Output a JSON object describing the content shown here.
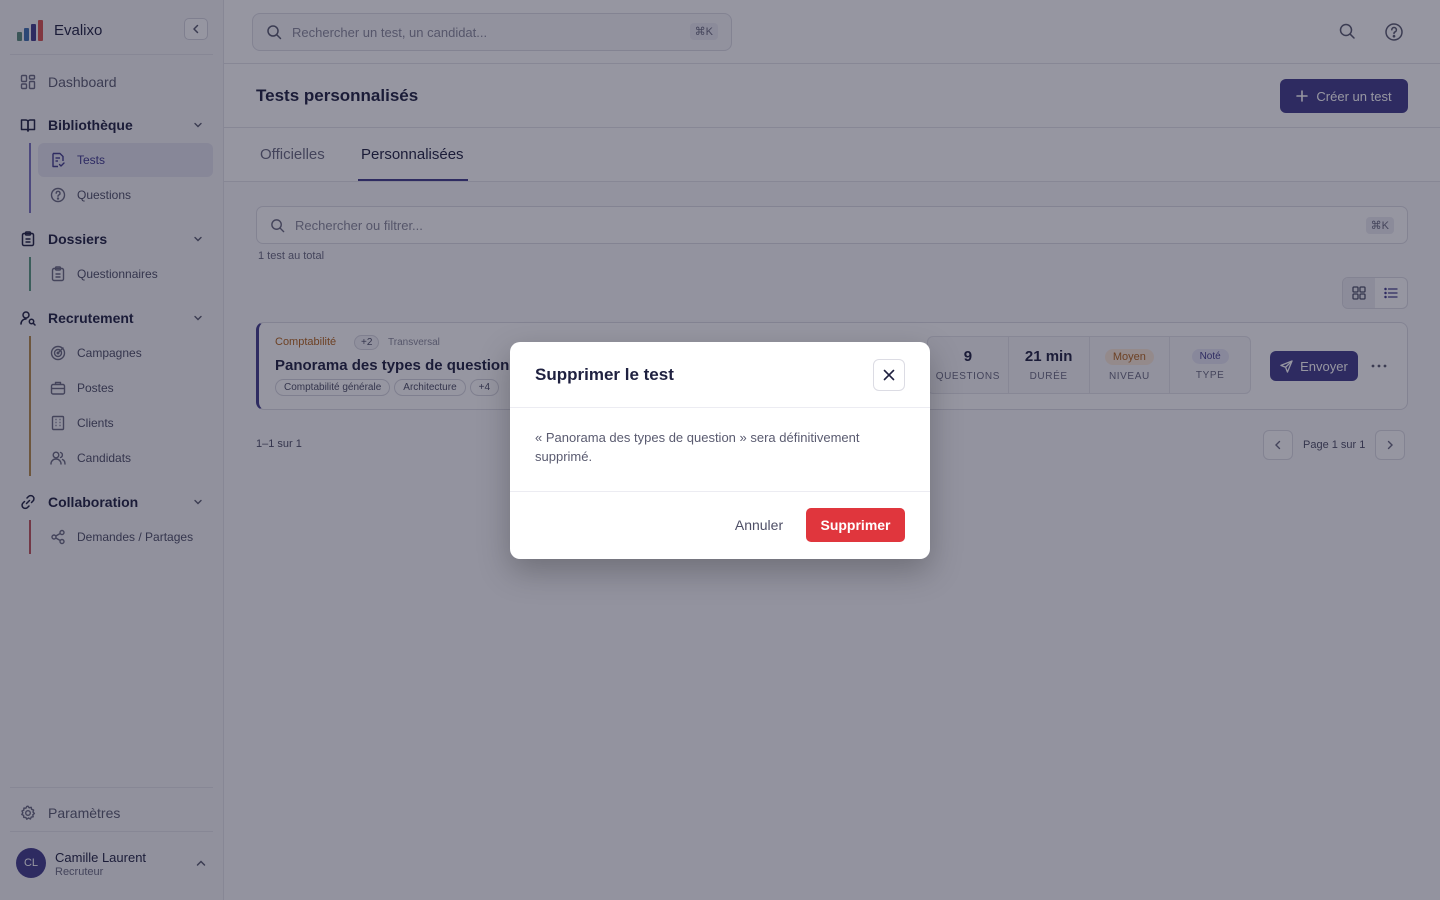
{
  "app": {
    "name": "Evalixo"
  },
  "sidebar": {
    "dashboard": "Dashboard",
    "sections": [
      {
        "label": "Bibliothèque",
        "items": [
          {
            "label": "Tests",
            "active": true
          },
          {
            "label": "Questions"
          }
        ]
      },
      {
        "label": "Dossiers",
        "items": [
          {
            "label": "Questionnaires"
          }
        ]
      },
      {
        "label": "Recrutement",
        "items": [
          {
            "label": "Campagnes"
          },
          {
            "label": "Postes"
          },
          {
            "label": "Clients"
          },
          {
            "label": "Candidats"
          }
        ]
      },
      {
        "label": "Collaboration",
        "items": [
          {
            "label": "Demandes / Partages"
          }
        ]
      }
    ],
    "settings": "Paramètres",
    "user": {
      "initials": "CL",
      "name": "Camille Laurent",
      "role": "Recruteur"
    }
  },
  "topbar": {
    "search_placeholder": "Rechercher un test, un candidat...",
    "shortcut": "⌘K"
  },
  "header": {
    "title": "Tests personnalisés",
    "create_label": "Créer un test"
  },
  "tabs": [
    {
      "label": "Officielles"
    },
    {
      "label": "Personnalisées",
      "active": true
    }
  ],
  "filter": {
    "placeholder": "Rechercher ou filtrer...",
    "shortcut": "⌘K",
    "count": "1 test au total"
  },
  "test_card": {
    "category": "Comptabilité",
    "category_more": "+2",
    "scope": "Transversal",
    "title": "Panorama des types de question",
    "tags": [
      "Comptabilité générale",
      "Architecture",
      "+4"
    ],
    "stats": {
      "questions": {
        "value": "9",
        "label": "Questions"
      },
      "duration": {
        "value": "21 min",
        "label": "Durée"
      },
      "level": {
        "value": "Moyen",
        "label": "Niveau"
      },
      "type": {
        "value": "Noté",
        "label": "Type"
      }
    },
    "send_label": "Envoyer"
  },
  "pagination": {
    "range": "1–1 sur 1",
    "page_label": "Page 1 sur 1"
  },
  "modal": {
    "title": "Supprimer le test",
    "message": "« Panorama des types de question » sera définitivement supprimé.",
    "cancel_label": "Annuler",
    "confirm_label": "Supprimer"
  },
  "colors": {
    "accent": "#433d8b",
    "danger": "#e0363d",
    "level_badge": "#b5651d"
  }
}
